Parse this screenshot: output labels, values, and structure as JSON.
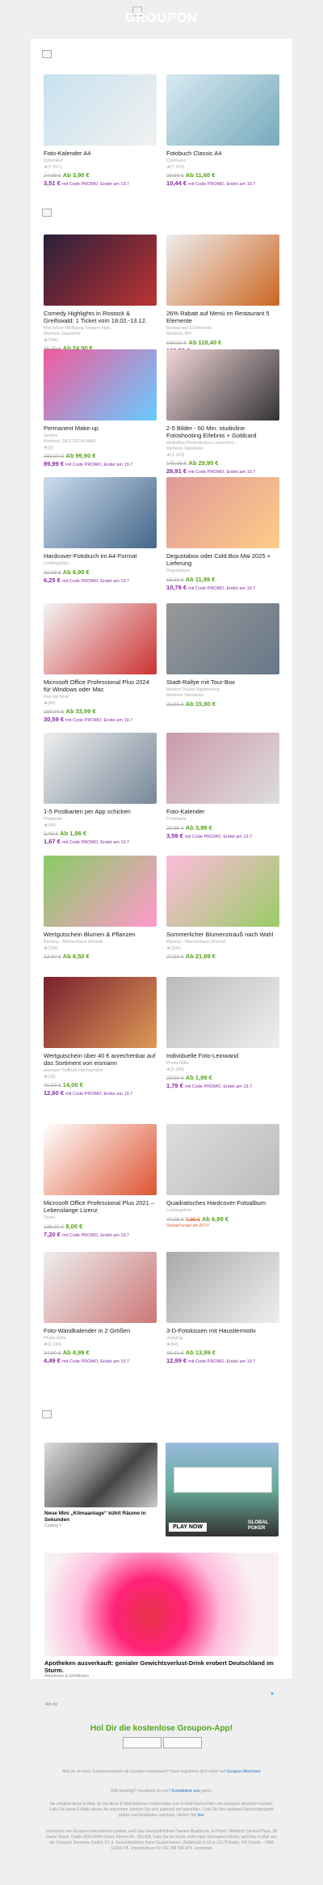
{
  "brand": {
    "logo_text": "GROUPON"
  },
  "deals": [
    {
      "title": "Foto-Kalender A4",
      "sub": "Colorland",
      "rating": "(7 207)",
      "old": "24,99 €",
      "ab": "Ab 3,90 €",
      "promo": "3,51 €",
      "promo_text": "mit Code PROMO, Endet am 19.7"
    },
    {
      "title": "Fotobuch Classic A4",
      "sub": "Colorland",
      "rating": "(7 220)",
      "old": "29,99 €",
      "ab": "Ab 11,60 €",
      "promo": "10,44 €",
      "promo_text": "mit Code PROMO, Endet am 19.7"
    },
    {
      "title": "Comedy Highlights in Rostock & Greifswald: 1 Ticket vom 18.02.-13.12.",
      "sub": "Mrs-Show-Wolfgang Trepper high...\nMehrere Standorte",
      "rating": "(745)",
      "old": "35,70 €",
      "ab": "Ab 24,90 €",
      "promo": "",
      "promo_text": ""
    },
    {
      "title": "26% Rabatt auf Menü im Restaurant 5 Elemente",
      "sub": "Restaurant 5 Elemente\nRostock, MV",
      "rating": "",
      "old": "160,00 €",
      "ab": "Ab 118,40 €",
      "promo": "106,56 €",
      "promo_text": "mit Code PROMO, Endet am 19.7"
    },
    {
      "title": "Permanent Make-up",
      "sub": "Selena\nRostock, DEUTSCHLAND",
      "rating": "(9)",
      "old": "280,00 €",
      "ab": "Ab 99,90 €",
      "promo": "89,99 €",
      "promo_text": "mit Code PROMO, Endet am 19.7"
    },
    {
      "title": "2-5 Bilder - 60 Min. studioline Fotoshooting Erlebnis + Goldcard",
      "sub": "studioline Photostudios Lieventery...\nMehrere Standorte",
      "rating": "(1 123)",
      "old": "149,98 €",
      "ab": "Ab 29,90 €",
      "promo": "26,91 €",
      "promo_text": "mit Code PROMO, Endet am 19.7"
    },
    {
      "title": "Hardcover-Fotobuch im A4-Format",
      "sub": "Lieblingsfoto",
      "rating": "",
      "old": "39,95 €",
      "ab": "Ab 6,95 €",
      "promo": "6,25 €",
      "promo_text": "mit Code PROMO, Endet am 19.7"
    },
    {
      "title": "Degustabox oder Cold Box Mai 2025 + Lieferung",
      "sub": "Degustabox",
      "rating": "",
      "old": "15,99 €",
      "ab": "Ab 11,99 €",
      "promo": "10,79 €",
      "promo_text": "mit Code PROMO, Endet am 19.7"
    },
    {
      "title": "Microsoft Office Professional Plus 2024 für Windows oder Mac",
      "sub": "Key-Up Now",
      "rating": "(86)",
      "old": "189,94 €",
      "ab": "Ab 33,99 €",
      "promo": "30,59 €",
      "promo_text": "mit Code PROMO, Endet am 19.7"
    },
    {
      "title": "Stadt-Rallye mit Tour-Box",
      "sub": "Munich Tourist Sightseeing\nMehrere Standorte",
      "rating": "",
      "old": "22,90 €",
      "ab": "Ab 15,90 €",
      "promo": "",
      "promo_text": ""
    },
    {
      "title": "1-5 Postkarten per App schicken",
      "sub": "Postando",
      "rating": "(40)",
      "old": "2,49 €",
      "ab": "Ab 1,86 €",
      "promo": "1,67 €",
      "promo_text": "mit Code PROMO, Endet am 19.7"
    },
    {
      "title": "Foto-Kalender",
      "sub": "Printeeple",
      "rating": "",
      "old": "20,95 €",
      "ab": "Ab 3,99 €",
      "promo": "3,59 €",
      "promo_text": "mit Code PROMO, Endet am 19.7"
    },
    {
      "title": "Wertgutschein Blumen & Pflanzen",
      "sub": "Bloomy - Blumenhaus Ehrend",
      "rating": "(199)",
      "old": "13,00 €",
      "ab": "Ab 6,50 €",
      "promo": "",
      "promo_text": ""
    },
    {
      "title": "Sommerlicher Blumenstrauß nach Wahl",
      "sub": "Bloomy - Blumenhaus Ehrend",
      "rating": "(199)",
      "old": "27,58 €",
      "ab": "Ab 21,99 €",
      "promo": "",
      "promo_text": ""
    },
    {
      "title": "Wertgutschein über 40 € anrechenbar auf das Sortiment von eismann",
      "sub": "eismann Tiefkühl-Heimservice",
      "rating": "(29)",
      "old": "40,00 €",
      "ab": "14,00 €",
      "promo": "12,60 €",
      "promo_text": "mit Code PROMO, Endet am 19.7"
    },
    {
      "title": "Individuelle Foto-Leinwand",
      "sub": "Photo Gifts",
      "rating": "(2 245)",
      "old": "29,90 €",
      "ab": "Ab 1,99 €",
      "promo": "1,79 €",
      "promo_text": "mit Code PROMO, Endet am 19.7"
    },
    {
      "title": "Microsoft Office Professional Plus 2021 – Lebenslange Lizenz",
      "sub": "Divoo",
      "rating": "",
      "old": "136,00 €",
      "ab": "8,00 €",
      "promo": "7,20 €",
      "promo_text": "mit Code PROMO, Endet am 19.7"
    },
    {
      "title": "Quadratisches Hardcover-Fotoalbum",
      "sub": "Lieblingsfoto",
      "rating": "",
      "old": "44,95 €",
      "ab": "Ab 6,99 €",
      "promo": "",
      "promo_text": "",
      "mid": "7,99 €",
      "note": "Verkauf endet am 20.07"
    },
    {
      "title": "Foto-Wandkalender in 2 Größen",
      "sub": "Photo Gifts",
      "rating": "(2 245)",
      "old": "24,90 €",
      "ab": "Ab 4,99 €",
      "promo": "4,49 €",
      "promo_text": "mit Code PROMO, Endet am 19.7"
    },
    {
      "title": "3-D-Fotokissen mit Haustiermotiv",
      "sub": "Justphig",
      "rating": "(64)",
      "old": "49,41 €",
      "ab": "Ab 13,99 €",
      "promo": "12,99 €",
      "promo_text": "mit Code PROMO, Endet am 19.7"
    }
  ],
  "ads": {
    "left_title": "Neue Mini „Klimaanlage“ kühlt Räume in Sekunden",
    "left_src": "Cooling Y",
    "right_overlay": "PLAY NOW",
    "right_badge": "GLOBAL POKER",
    "big_title": "Apotheken ausverkauft: genialer Gewichtsverlust-Drink erobert Deutschland im Sturm.",
    "big_src": "Abnehmen & Wohlfühlen",
    "adchoice": "Ads by"
  },
  "app": {
    "title": "Hol Dir die kostenlose Groupon-App!"
  },
  "footer": {
    "l1": "Bist du an einer Zusammenarbeit mit Groupon interessiert? Dann registriere dich sofort auf",
    "l1_link": "Groupon Merchant",
    "l2": "Hilfe benötigt? Feedback an uns?",
    "l2_link": "Kontaktiere uns",
    "l2b": "gerne.",
    "l3": "Sie erhalten diese E-Mail, da Sie diese E-Mail-Adresse exellioneake zum E-Mail-Nachrichten von Groupon abonniert wurden. Falls Sie keine E-Mails dieser Art wünschen, können Sie sich jederzeit mit abmelden. Falls Sie Ihre anderen Nachrichtenprofil prüfen und bearbeiten möchten, klicken Sie",
    "l3_link": "hier",
    "l4": "Versendet von Groupon International Limited, weiß das Geschäftsführer Damien Bradbrook Jni Poinri, Wetbirch Central Plaza, 36 Dame Street, Dublin D02 EF6H Irland, Firmen-Nr.: 501308, Falls Sie Ihr Konto nicht mehr überlagern führen, wird Ihre E-Mail von der Groupon Germany GmbH, Ct. d. Geschäftsführer Karel Gurpenhaven, Wallstraße 9-13 in 10179 Berlin, HG Charlb. - HRB 123012 B, Umsatzsteuer-ID: DE 268 596 674, versendet"
  },
  "colors": {
    "green": "#53a318",
    "purple": "#8a2aa6",
    "bg": "#efefef"
  }
}
